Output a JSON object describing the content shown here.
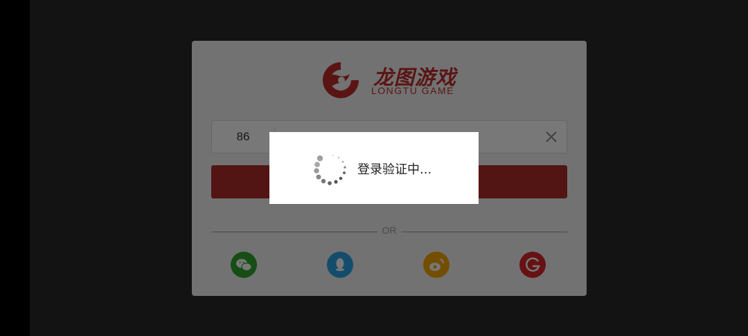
{
  "logo": {
    "cn": "龙图游戏",
    "en": "LONGTU GAME"
  },
  "phone": {
    "country_code": "86",
    "value": "",
    "placeholder": ""
  },
  "login_button": {
    "label": ""
  },
  "divider": {
    "or": "OR"
  },
  "social": [
    {
      "name": "wechat",
      "color": "#2fa62f"
    },
    {
      "name": "qq",
      "color": "#2aa3e3"
    },
    {
      "name": "weibo",
      "color": "#f4a500"
    },
    {
      "name": "longtu",
      "color": "#d8262a"
    }
  ],
  "colors": {
    "brand_red": "#c22b2b",
    "button_red": "#b12a2a"
  },
  "loading": {
    "text": "登录验证中..."
  }
}
